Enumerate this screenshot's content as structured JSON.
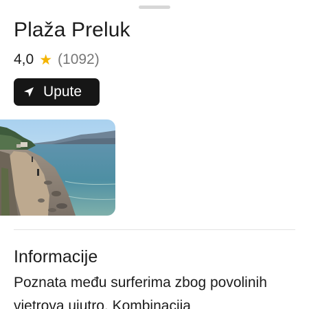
{
  "place": {
    "name": "Plaža Preluk",
    "rating": "4,0",
    "rating_icon": "star-icon",
    "review_count": "(1092)"
  },
  "actions": {
    "directions_label": "Upute",
    "directions_icon": "navigation-arrow-icon"
  },
  "info": {
    "heading": "Informacije",
    "description": "Poznata među surferima zbog povolinih vietrova ujutro. Kombinacija"
  },
  "colors": {
    "star": "#f4b400",
    "button_bg": "#161616",
    "secondary_text": "#777777"
  }
}
